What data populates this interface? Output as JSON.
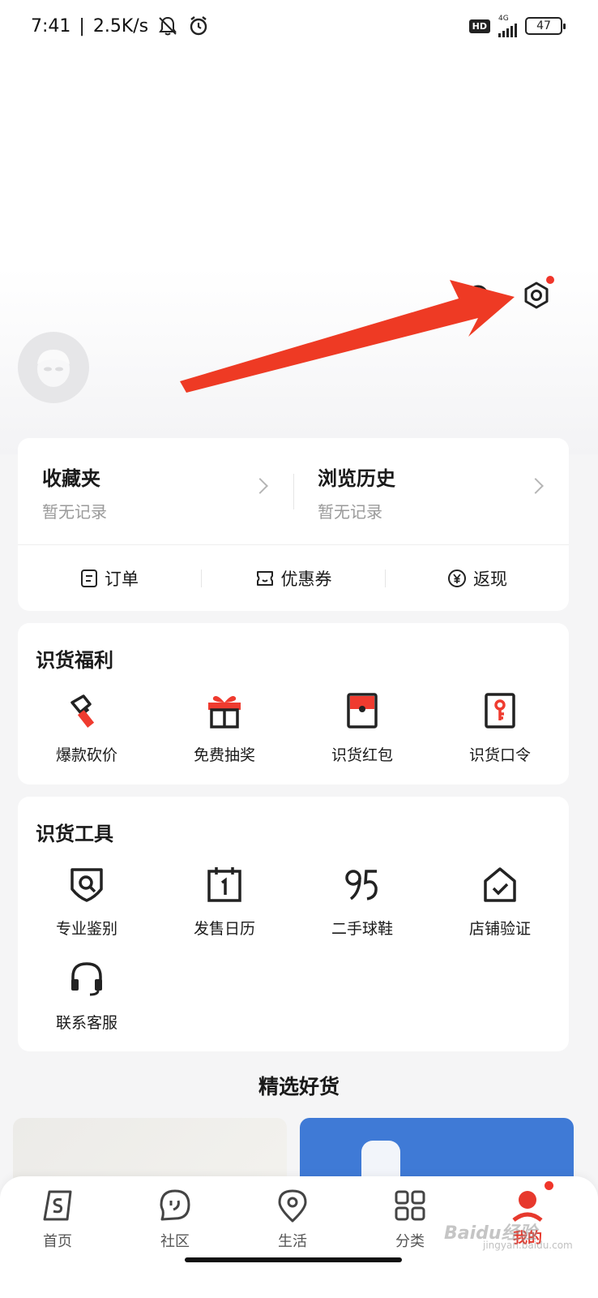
{
  "status_bar": {
    "time": "7:41",
    "speed": "2.5K/s",
    "hd": "HD",
    "network": "4G",
    "battery": "47",
    "icons": [
      "bell-muted-icon",
      "alarm-icon",
      "signal-icon",
      "battery-icon"
    ]
  },
  "header": {
    "icons": [
      "message-icon",
      "settings-icon"
    ],
    "settings_badge_color": "#f0352a"
  },
  "annotation": {
    "arrow_color": "#ee3a24"
  },
  "records": {
    "favorites": {
      "title": "收藏夹",
      "subtitle": "暂无记录"
    },
    "history": {
      "title": "浏览历史",
      "subtitle": "暂无记录"
    }
  },
  "quick_links": [
    {
      "label": "订单",
      "icon": "order-icon"
    },
    {
      "label": "优惠券",
      "icon": "coupon-icon"
    },
    {
      "label": "返现",
      "icon": "cashback-icon"
    }
  ],
  "welfare": {
    "title": "识货福利",
    "items": [
      {
        "label": "爆款砍价",
        "icon": "axe-icon"
      },
      {
        "label": "免费抽奖",
        "icon": "gift-icon"
      },
      {
        "label": "识货红包",
        "icon": "red-packet-icon"
      },
      {
        "label": "识货口令",
        "icon": "key-code-icon"
      }
    ]
  },
  "tools": {
    "title": "识货工具",
    "items": [
      {
        "label": "专业鉴别",
        "icon": "authenticate-icon"
      },
      {
        "label": "发售日历",
        "icon": "calendar-icon"
      },
      {
        "label": "二手球鞋",
        "icon": "secondhand-icon"
      },
      {
        "label": "店铺验证",
        "icon": "shop-verify-icon"
      },
      {
        "label": "联系客服",
        "icon": "headset-icon"
      }
    ]
  },
  "featured": {
    "title": "精选好货"
  },
  "tab_bar": {
    "active_color": "#e7392d",
    "items": [
      {
        "label": "首页",
        "icon": "home-icon"
      },
      {
        "label": "社区",
        "icon": "community-icon"
      },
      {
        "label": "生活",
        "icon": "location-icon"
      },
      {
        "label": "分类",
        "icon": "category-icon"
      },
      {
        "label": "我的",
        "icon": "profile-icon"
      }
    ]
  },
  "watermark": {
    "text": "Baidu经验",
    "sub": "jingyan.baidu.com"
  }
}
